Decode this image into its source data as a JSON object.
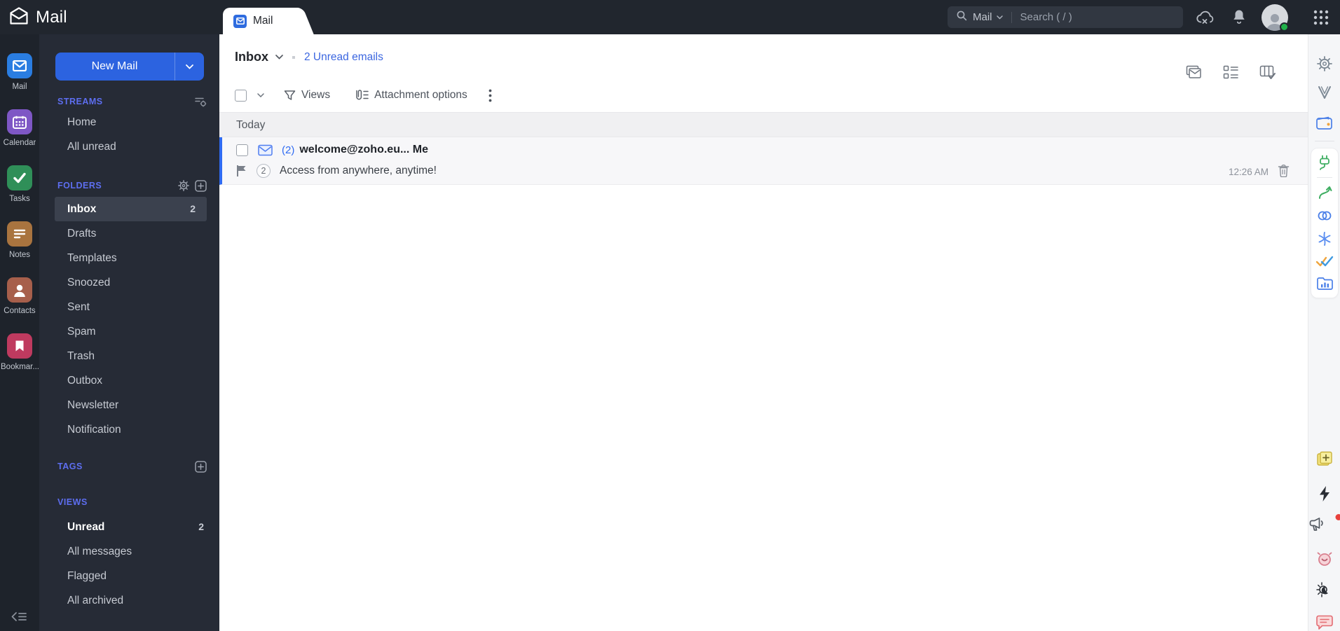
{
  "topbar": {
    "app_title": "Mail",
    "tab_label": "Mail",
    "search_scope": "Mail",
    "search_placeholder": "Search ( / )"
  },
  "left_rail": {
    "items": [
      {
        "label": "Mail",
        "color": "#2a7de1"
      },
      {
        "label": "Calendar",
        "color": "#7e57c5"
      },
      {
        "label": "Tasks",
        "color": "#2f8f58"
      },
      {
        "label": "Notes",
        "color": "#a9743f"
      },
      {
        "label": "Contacts",
        "color": "#a75f4b"
      },
      {
        "label": "Bookmar...",
        "color": "#bf3a5f"
      }
    ]
  },
  "sidebar": {
    "new_mail_label": "New Mail",
    "streams": {
      "title": "STREAMS",
      "items": [
        {
          "label": "Home"
        },
        {
          "label": "All unread"
        }
      ]
    },
    "folders": {
      "title": "FOLDERS",
      "items": [
        {
          "label": "Inbox",
          "count": "2"
        },
        {
          "label": "Drafts"
        },
        {
          "label": "Templates"
        },
        {
          "label": "Snoozed"
        },
        {
          "label": "Sent"
        },
        {
          "label": "Spam"
        },
        {
          "label": "Trash"
        },
        {
          "label": "Outbox"
        },
        {
          "label": "Newsletter"
        },
        {
          "label": "Notification"
        }
      ]
    },
    "tags": {
      "title": "TAGS"
    },
    "views": {
      "title": "VIEWS",
      "items": [
        {
          "label": "Unread",
          "count": "2"
        },
        {
          "label": "All messages"
        },
        {
          "label": "Flagged"
        },
        {
          "label": "All archived"
        }
      ]
    }
  },
  "main": {
    "folder_title": "Inbox",
    "unread_summary": "2 Unread emails",
    "toolbar": {
      "views_label": "Views",
      "attachment_label": "Attachment options"
    },
    "group_header": "Today",
    "email": {
      "thread_count": "(2)",
      "sender": "welcome@zoho.eu... Me",
      "badge": "2",
      "subject": "Access from anywhere, anytime!",
      "time": "12:26 AM"
    }
  },
  "colors": {
    "topbar_bg": "#21262e",
    "sidebar_bg": "#262b36",
    "accent_blue": "#2c63e0",
    "link_blue": "#3b66e0",
    "unread_border": "#2f6bf2",
    "presence_green": "#21b24c"
  }
}
